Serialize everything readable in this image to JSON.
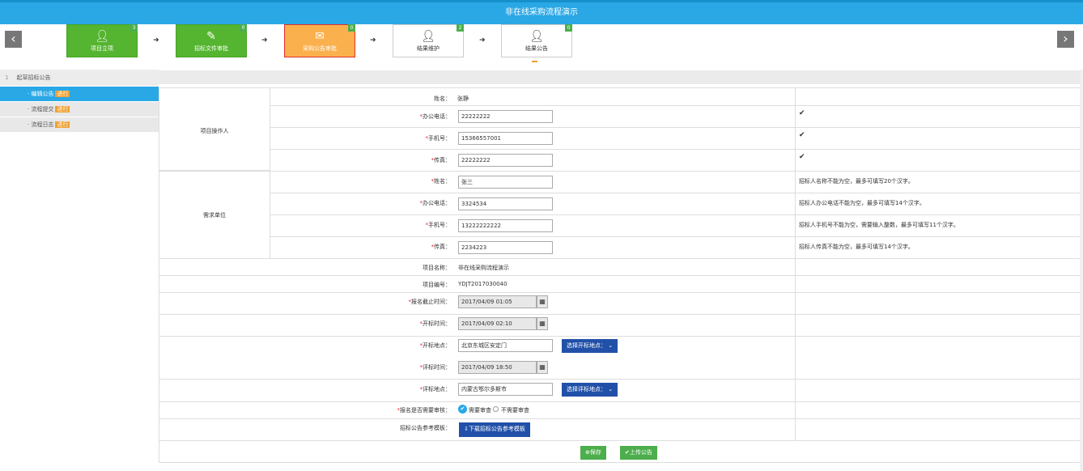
{
  "header": {
    "title": "非在线采购流程演示"
  },
  "flow": {
    "steps": [
      {
        "label": "项目立项",
        "badge": "3"
      },
      {
        "label": "招标文件审批",
        "badge": "0"
      },
      {
        "label": "采购公告审批",
        "badge": "0"
      },
      {
        "label": "结果维护",
        "badge": "2"
      },
      {
        "label": "结果公告",
        "badge": "0"
      }
    ],
    "prev_glyph": "‹",
    "next_glyph": "›",
    "arrow_glyph": "➜"
  },
  "sidebar": {
    "head_num": "1",
    "head_label": "起草招标公告",
    "items": [
      {
        "label": "· 编辑公告",
        "tag": "进行"
      },
      {
        "label": "· 流程提交",
        "tag": "进行"
      },
      {
        "label": "· 流程日志",
        "tag": "进行"
      }
    ]
  },
  "form": {
    "operator_group": "项目操作人",
    "buyer_group": "需求单位",
    "labels": {
      "name": "姓名：",
      "office_phone": "办公电话：",
      "mobile": "手机号：",
      "fax": "传真：",
      "project_name": "项目名称：",
      "project_no": "项目编号：",
      "signup_deadline": "报名截止时间：",
      "open_time": "开标时间：",
      "open_place": "开标地点：",
      "eval_time": "评标时间：",
      "eval_place": "评标地点：",
      "need_review": "报名是否需要审核：",
      "template": "招标公告参考模板："
    },
    "operator": {
      "name": "张静",
      "office_phone": "22222222",
      "mobile": "15366557001",
      "fax": "22222222"
    },
    "buyer": {
      "name": "张三",
      "office_phone": "3324534",
      "mobile": "13222222222",
      "fax": "2234223"
    },
    "project_name": "非在线采购流程演示",
    "project_no": "YDJT2017030040",
    "signup_deadline": "2017/04/09 01:05",
    "open_time": "2017/04/09 02:10",
    "open_place": "北京东城区安定门",
    "eval_time": "2017/04/09 18:50",
    "eval_place": "内蒙古鄂尔多斯市",
    "select_open_place": "选择开标地点：",
    "select_eval_place": "选择评标地点：",
    "review_yes": "需要审查",
    "review_no": "不需要审查",
    "download_template": "下载招标公告参考模板",
    "check_mark": "✔",
    "msgs": {
      "name": "招标人名称不能为空，最多可填写20个汉字。",
      "office_phone": "招标人办公电话不能为空，最多可填写14个汉字。",
      "mobile": "招标人手机号不能为空，需要输入整数，最多可填写11个汉字。",
      "fax": "招标人传真不能为空，最多可填写14个汉字。"
    },
    "save": "保存",
    "upload": "上传公告"
  }
}
